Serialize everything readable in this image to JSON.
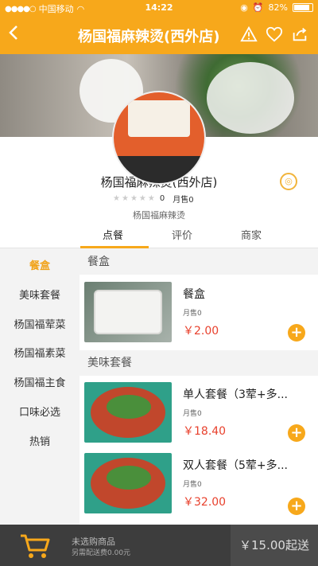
{
  "status_bar": {
    "carrier": "中国移动",
    "time": "14:22",
    "battery": "82%"
  },
  "nav": {
    "title": "杨国福麻辣烫(西外店)"
  },
  "shop": {
    "name": "杨国福麻辣烫(西外店)",
    "rating_value": "0",
    "monthly_sales": "月售0",
    "subtitle": "杨国福麻辣烫"
  },
  "tabs": [
    {
      "label": "点餐"
    },
    {
      "label": "评价"
    },
    {
      "label": "商家"
    }
  ],
  "categories": [
    {
      "label": "餐盒"
    },
    {
      "label": "美味套餐"
    },
    {
      "label": "杨国福荤菜"
    },
    {
      "label": "杨国福素菜"
    },
    {
      "label": "杨国福主食"
    },
    {
      "label": "口味必选"
    },
    {
      "label": "热销"
    }
  ],
  "menu": {
    "sections": [
      {
        "title": "餐盒"
      },
      {
        "title": "美味套餐"
      }
    ],
    "items": [
      {
        "name": "餐盒",
        "sales": "月售0",
        "price": "￥2.00"
      },
      {
        "name": "单人套餐（3荤+多...",
        "sales": "月售0",
        "price": "￥18.40"
      },
      {
        "name": "双人套餐（5荤+多...",
        "sales": "月售0",
        "price": "￥32.00"
      }
    ]
  },
  "bottom_bar": {
    "cart_status": "未选购商品",
    "delivery_fee": "另需配送费0.00元",
    "checkout": "￥15.00起送"
  },
  "colors": {
    "brand_orange": "#f7a81b",
    "price_red": "#e8412d",
    "bottom_bar": "#3d3d3d"
  }
}
